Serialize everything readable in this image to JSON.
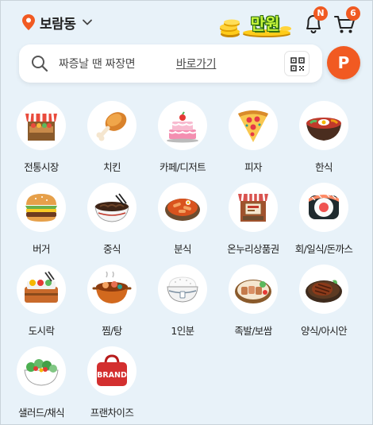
{
  "header": {
    "location": "보람동",
    "coin_text": "만원",
    "bell_badge": "N",
    "cart_badge": "6"
  },
  "search": {
    "placeholder": "짜증날 땐 짜장면",
    "link": "바로가기"
  },
  "point_button": "P",
  "categories": [
    {
      "label": "전통시장",
      "icon": "market-stall-icon"
    },
    {
      "label": "치킨",
      "icon": "chicken-leg-icon"
    },
    {
      "label": "카페/디저트",
      "icon": "cake-icon"
    },
    {
      "label": "피자",
      "icon": "pizza-slice-icon"
    },
    {
      "label": "한식",
      "icon": "bibimbap-bowl-icon"
    },
    {
      "label": "버거",
      "icon": "burger-icon"
    },
    {
      "label": "중식",
      "icon": "noodle-bowl-icon"
    },
    {
      "label": "분식",
      "icon": "tteokbokki-bowl-icon"
    },
    {
      "label": "온누리상품권",
      "icon": "voucher-stall-icon"
    },
    {
      "label": "회/일식/돈까스",
      "icon": "sushi-icon"
    },
    {
      "label": "도시락",
      "icon": "lunchbox-icon"
    },
    {
      "label": "찜/탕",
      "icon": "stew-pot-icon"
    },
    {
      "label": "1인분",
      "icon": "rice-bowl-icon"
    },
    {
      "label": "족발/보쌈",
      "icon": "jokbal-plate-icon"
    },
    {
      "label": "양식/아시안",
      "icon": "steak-plate-icon"
    },
    {
      "label": "샐러드/채식",
      "icon": "salad-bowl-icon"
    },
    {
      "label": "프랜차이즈",
      "icon": "brand-bag-icon"
    }
  ],
  "brand_bag_text": "BRAND",
  "colors": {
    "accent": "#f15a22",
    "background": "#e8f2f9"
  }
}
